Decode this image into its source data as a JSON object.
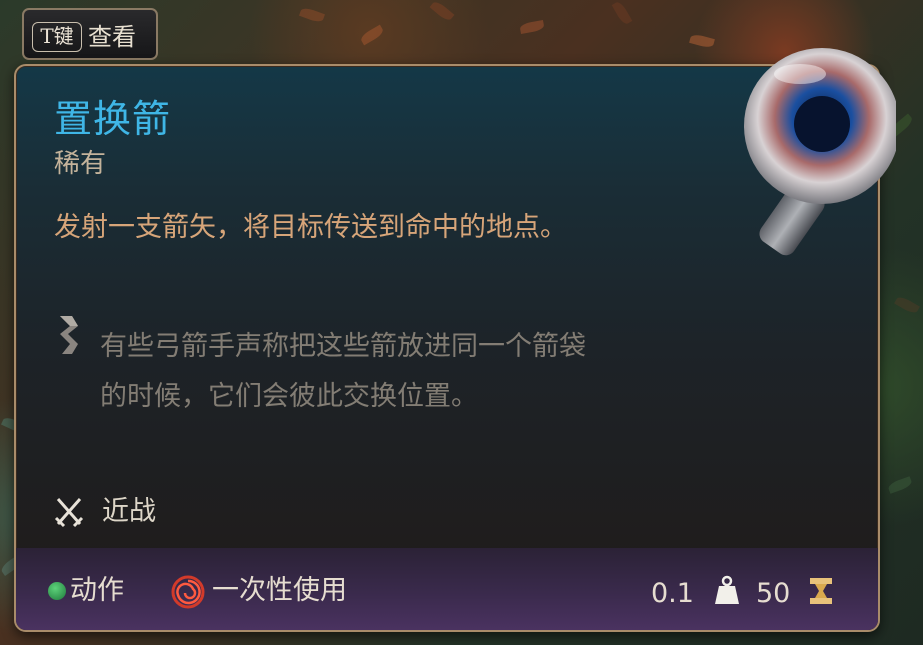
{
  "hint": {
    "key": "T键",
    "label": "查看"
  },
  "item": {
    "name": "置换箭",
    "rarity": "稀有",
    "description": "发射一支箭矢，将目标传送到命中的地点。",
    "flavor": "有些弓箭手声称把这些箭放进同一个箭袋的时候，它们会彼此交换位置。",
    "attack_type": "近战"
  },
  "footer": {
    "action": "动作",
    "usage": "一次性使用",
    "weight": "0.1",
    "value": "50"
  },
  "icons": {
    "flavor": "scroll-icon",
    "attack": "crossed-swords-icon",
    "action": "green-dot-icon",
    "usage": "red-spiral-icon",
    "weight": "weight-icon",
    "value": "gold-icon",
    "item": "arrow-orb-icon"
  },
  "colors": {
    "name": "#3fb6e6",
    "description": "#d7a579",
    "flavor": "#837d74",
    "border": "#a98c6a",
    "action": "#2fa153",
    "usage": "#d23a2a",
    "gold": "#e8c27a"
  }
}
